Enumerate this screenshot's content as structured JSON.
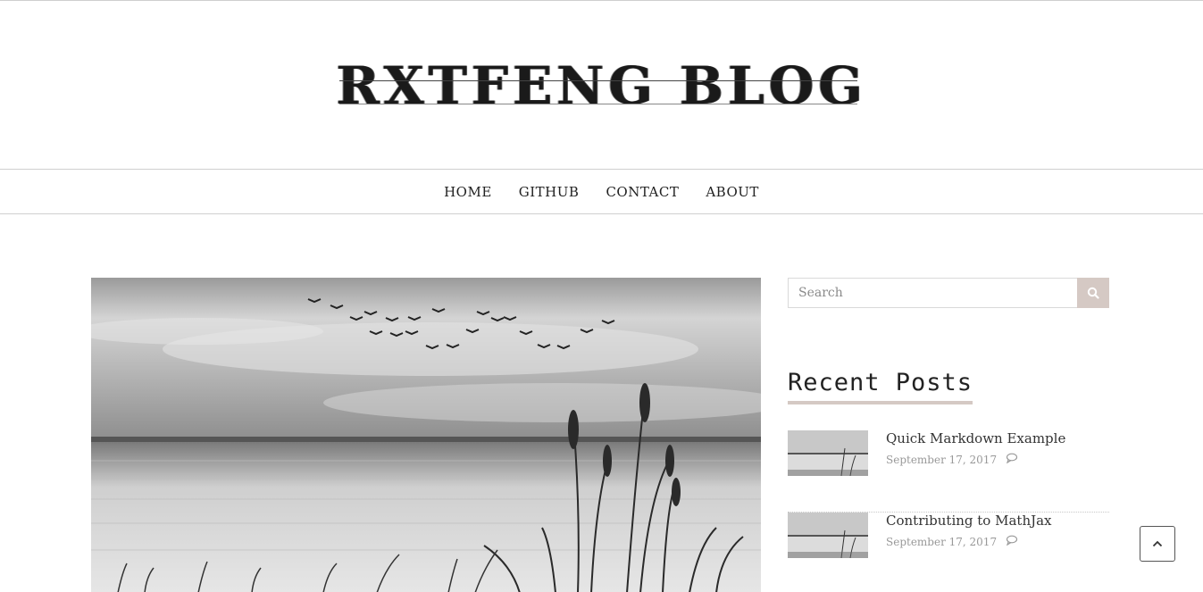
{
  "header": {
    "logo_text": "RXTFENG BLOG"
  },
  "nav": {
    "items": [
      "HOME",
      "GITHUB",
      "CONTACT",
      "ABOUT"
    ]
  },
  "sidebar": {
    "search": {
      "placeholder": "Search"
    },
    "recent_posts": {
      "title": "Recent Posts",
      "posts": [
        {
          "title": "Quick Markdown Example",
          "date": "September 17, 2017"
        },
        {
          "title": "Contributing to MathJax",
          "date": "September 17, 2017"
        }
      ]
    }
  },
  "icons": {
    "search": "search-icon",
    "comment": "comment-icon",
    "back_to_top": "chevron-up-icon"
  },
  "colors": {
    "accent": "#d5c9c4",
    "border": "#cfcfcf",
    "text": "#333333"
  }
}
